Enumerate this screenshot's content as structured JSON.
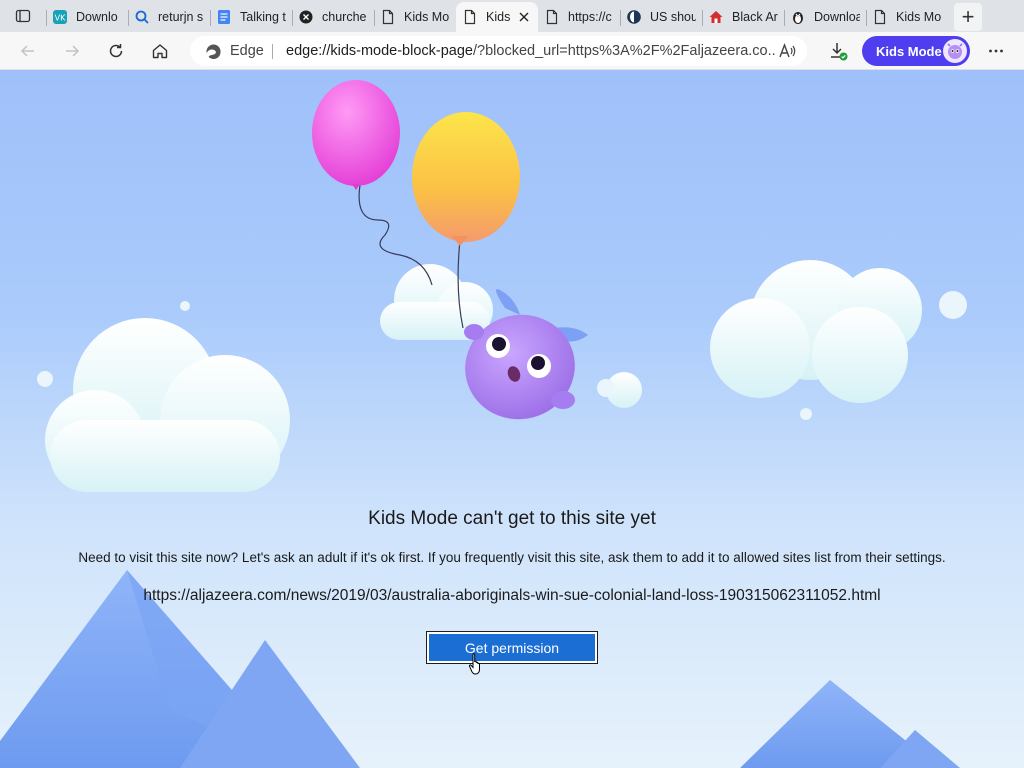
{
  "browser": {
    "tabs": [
      {
        "title": "Downlo",
        "icon": "vk-icon",
        "active": false
      },
      {
        "title": "returjn s",
        "icon": "search-icon",
        "active": false
      },
      {
        "title": "Talking t",
        "icon": "docs-icon",
        "active": false
      },
      {
        "title": "churche",
        "icon": "x-logo-icon",
        "active": false
      },
      {
        "title": "Kids Mo",
        "icon": "page-icon",
        "active": false
      },
      {
        "title": "Kids",
        "icon": "page-icon",
        "active": true
      },
      {
        "title": "https://c",
        "icon": "page-icon",
        "active": false
      },
      {
        "title": "US shou",
        "icon": "globe-icon",
        "active": false
      },
      {
        "title": "Black Ar",
        "icon": "house-icon",
        "active": false
      },
      {
        "title": "Downloa",
        "icon": "penguin-icon",
        "active": false
      },
      {
        "title": "Kids Mo",
        "icon": "page-icon",
        "active": false
      }
    ],
    "address": {
      "edge_label": "Edge",
      "url_host": "edge://kids-mode-block-page",
      "url_rest": "/?blocked_url=https%3A%2F%2Faljazeera.co..."
    },
    "kids_mode_label": "Kids Mode",
    "accent_color": "#4e3ef0"
  },
  "page": {
    "title": "Kids Mode can't get to this site yet",
    "body": "Need to visit this site now? Let's ask an adult if it's ok first. If you frequently visit this site, ask them to add it to allowed sites list from their settings.",
    "blocked_url": "https://aljazeera.com/news/2019/03/australia-aboriginals-win-sue-colonial-land-loss-190315062311052.html",
    "button_label": "Get permission",
    "button_color": "#1b6ed4"
  }
}
